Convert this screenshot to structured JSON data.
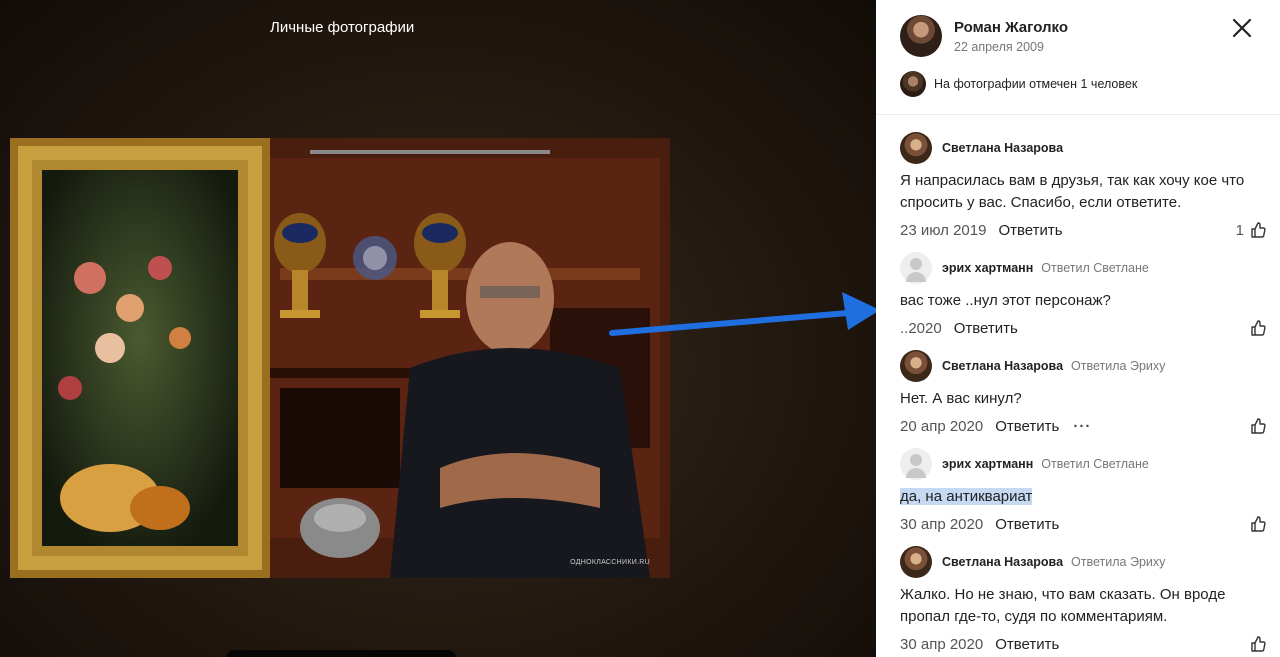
{
  "viewer": {
    "album_title": "Личные фотографии",
    "watermark": "ОДНОКЛАССНИКИ.RU"
  },
  "header": {
    "author_name": "Роман Жаголко",
    "date": "22 апреля 2009"
  },
  "tagged": {
    "text": "На фотографии отмечен 1 человек"
  },
  "comments": [
    {
      "author": "Светлана Назарова",
      "reply_to": "",
      "text": "Я напрасилась вам в друзья, так как хочу кое что спросить у вас. Спасибо, если ответите.",
      "date": "23 июл 2019",
      "answer_label": "Ответить",
      "likes": "1"
    },
    {
      "author": "эрих хартманн",
      "reply_to": "Ответил Светлане",
      "text": "вас тоже ..нул этот персонаж?",
      "date": "..2020",
      "answer_label": "Ответить",
      "likes": ""
    },
    {
      "author": "Светлана Назарова",
      "reply_to": "Ответила Эриху",
      "text": "Нет. А вас кинул?",
      "date": "20 апр 2020",
      "answer_label": "Ответить",
      "more": "···",
      "likes": ""
    },
    {
      "author": "эрих хартманн",
      "reply_to": "Ответил Светлане",
      "text": "да, на антиквариат",
      "date": "30 апр 2020",
      "answer_label": "Ответить",
      "likes": ""
    },
    {
      "author": "Светлана Назарова",
      "reply_to": "Ответила Эриху",
      "text": "Жалко. Но не знаю, что вам сказать. Он вроде пропал где-то, судя по комментариям.",
      "date": "30 апр 2020",
      "answer_label": "Ответить",
      "likes": ""
    }
  ],
  "colors": {
    "arrow": "#1f6fe0",
    "highlight": "#c5d9f2"
  }
}
